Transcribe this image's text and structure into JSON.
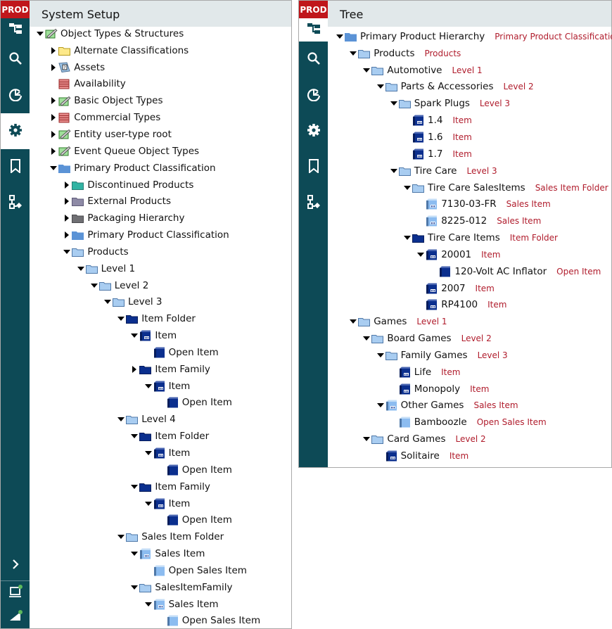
{
  "env_badge": "PROD",
  "left": {
    "title": "System Setup",
    "rail": [
      "hierarchy-icon",
      "search-icon",
      "refresh-icon",
      "gear-icon",
      "bookmark-icon",
      "workflow-icon"
    ],
    "active_rail": 3,
    "rail_bottom": [
      "expand-chevron-icon",
      "laptop-status-icon",
      "signal-status-icon"
    ],
    "tree": [
      {
        "d": 0,
        "t": "down",
        "i": "objtype",
        "l": "Object Types & Structures"
      },
      {
        "d": 1,
        "t": "right",
        "i": "folder-yellow",
        "l": "Alternate Classifications"
      },
      {
        "d": 1,
        "t": "right",
        "i": "asset",
        "l": "Assets"
      },
      {
        "d": 1,
        "t": "none",
        "i": "list-red",
        "l": "Availability"
      },
      {
        "d": 1,
        "t": "right",
        "i": "objtype",
        "l": "Basic Object Types"
      },
      {
        "d": 1,
        "t": "right",
        "i": "list-red",
        "l": "Commercial Types"
      },
      {
        "d": 1,
        "t": "right",
        "i": "objtype",
        "l": "Entity user-type root"
      },
      {
        "d": 1,
        "t": "right",
        "i": "objtype",
        "l": "Event Queue Object Types"
      },
      {
        "d": 1,
        "t": "down",
        "i": "folder-blue",
        "l": "Primary Product Classification"
      },
      {
        "d": 2,
        "t": "right",
        "i": "folder-teal",
        "l": "Discontinued Products"
      },
      {
        "d": 2,
        "t": "right",
        "i": "folder-purple",
        "l": "External Products"
      },
      {
        "d": 2,
        "t": "right",
        "i": "folder-gray",
        "l": "Packaging Hierarchy"
      },
      {
        "d": 2,
        "t": "right",
        "i": "folder-blue",
        "l": "Primary Product Classification"
      },
      {
        "d": 2,
        "t": "down",
        "i": "folder-light",
        "l": "Products"
      },
      {
        "d": 3,
        "t": "down",
        "i": "folder-light",
        "l": "Level 1"
      },
      {
        "d": 4,
        "t": "down",
        "i": "folder-light",
        "l": "Level 2"
      },
      {
        "d": 5,
        "t": "down",
        "i": "folder-light",
        "l": "Level 3"
      },
      {
        "d": 6,
        "t": "down",
        "i": "folder-dark",
        "l": "Item Folder"
      },
      {
        "d": 7,
        "t": "down",
        "i": "item",
        "l": "Item"
      },
      {
        "d": 8,
        "t": "none",
        "i": "open-item",
        "l": "Open Item"
      },
      {
        "d": 7,
        "t": "right",
        "i": "folder-dark",
        "l": "Item Family"
      },
      {
        "d": 8,
        "t": "down",
        "i": "item",
        "l": "Item"
      },
      {
        "d": 9,
        "t": "none",
        "i": "open-item",
        "l": "Open Item"
      },
      {
        "d": 6,
        "t": "down",
        "i": "folder-light",
        "l": "Level 4"
      },
      {
        "d": 7,
        "t": "down",
        "i": "folder-dark",
        "l": "Item Folder"
      },
      {
        "d": 8,
        "t": "down",
        "i": "item",
        "l": "Item"
      },
      {
        "d": 9,
        "t": "none",
        "i": "open-item",
        "l": "Open Item"
      },
      {
        "d": 7,
        "t": "down",
        "i": "folder-dark",
        "l": "Item Family"
      },
      {
        "d": 8,
        "t": "down",
        "i": "item",
        "l": "Item"
      },
      {
        "d": 9,
        "t": "none",
        "i": "open-item",
        "l": "Open Item"
      },
      {
        "d": 6,
        "t": "down",
        "i": "folder-light",
        "l": "Sales Item Folder"
      },
      {
        "d": 7,
        "t": "down",
        "i": "sales-item",
        "l": "Sales Item"
      },
      {
        "d": 8,
        "t": "none",
        "i": "open-sales",
        "l": "Open Sales Item"
      },
      {
        "d": 7,
        "t": "down",
        "i": "folder-light",
        "l": "SalesItemFamily"
      },
      {
        "d": 8,
        "t": "down",
        "i": "sales-item",
        "l": "Sales Item"
      },
      {
        "d": 9,
        "t": "none",
        "i": "open-sales",
        "l": "Open Sales Item"
      }
    ]
  },
  "right": {
    "title": "Tree",
    "rail": [
      "hierarchy-icon",
      "search-icon",
      "refresh-icon",
      "gear-icon",
      "bookmark-icon",
      "workflow-icon"
    ],
    "active_rail": 0,
    "tree": [
      {
        "d": 0,
        "t": "down",
        "i": "folder-blue",
        "l": "Primary Product Hierarchy",
        "s": "Primary Product Classification"
      },
      {
        "d": 1,
        "t": "down",
        "i": "folder-light",
        "l": "Products",
        "s": "Products"
      },
      {
        "d": 2,
        "t": "down",
        "i": "folder-light",
        "l": "Automotive",
        "s": "Level 1"
      },
      {
        "d": 3,
        "t": "down",
        "i": "folder-light",
        "l": "Parts & Accessories",
        "s": "Level 2"
      },
      {
        "d": 4,
        "t": "down",
        "i": "folder-light",
        "l": "Spark Plugs",
        "s": "Level 3"
      },
      {
        "d": 5,
        "t": "none",
        "i": "item",
        "l": "1.4",
        "s": "Item"
      },
      {
        "d": 5,
        "t": "none",
        "i": "item",
        "l": "1.6",
        "s": "Item"
      },
      {
        "d": 5,
        "t": "none",
        "i": "item",
        "l": "1.7",
        "s": "Item"
      },
      {
        "d": 4,
        "t": "down",
        "i": "folder-light",
        "l": "Tire Care",
        "s": "Level 3"
      },
      {
        "d": 5,
        "t": "down",
        "i": "folder-light",
        "l": "Tire Care SalesItems",
        "s": "Sales Item Folder"
      },
      {
        "d": 6,
        "t": "none",
        "i": "sales-item",
        "l": "7130-03-FR",
        "s": "Sales Item"
      },
      {
        "d": 6,
        "t": "none",
        "i": "sales-item",
        "l": "8225-012",
        "s": "Sales Item"
      },
      {
        "d": 5,
        "t": "down",
        "i": "folder-dark",
        "l": "Tire Care Items",
        "s": "Item Folder"
      },
      {
        "d": 6,
        "t": "down",
        "i": "item",
        "l": "20001",
        "s": "Item"
      },
      {
        "d": 7,
        "t": "none",
        "i": "open-item",
        "l": "120-Volt AC Inflator",
        "s": "Open Item"
      },
      {
        "d": 6,
        "t": "none",
        "i": "item",
        "l": "2007",
        "s": "Item"
      },
      {
        "d": 6,
        "t": "none",
        "i": "item",
        "l": "RP4100",
        "s": "Item"
      },
      {
        "d": 1,
        "t": "down",
        "i": "folder-light",
        "l": "Games",
        "s": "Level 1"
      },
      {
        "d": 2,
        "t": "down",
        "i": "folder-light",
        "l": "Board Games",
        "s": "Level 2"
      },
      {
        "d": 3,
        "t": "down",
        "i": "folder-light",
        "l": "Family Games",
        "s": "Level 3"
      },
      {
        "d": 4,
        "t": "none",
        "i": "item",
        "l": "Life",
        "s": "Item"
      },
      {
        "d": 4,
        "t": "none",
        "i": "item",
        "l": "Monopoly",
        "s": "Item"
      },
      {
        "d": 3,
        "t": "down",
        "i": "sales-item",
        "l": "Other Games",
        "s": "Sales Item"
      },
      {
        "d": 4,
        "t": "none",
        "i": "open-sales",
        "l": "Bamboozle",
        "s": "Open Sales Item"
      },
      {
        "d": 2,
        "t": "down",
        "i": "folder-light",
        "l": "Card Games",
        "s": "Level 2"
      },
      {
        "d": 3,
        "t": "none",
        "i": "item",
        "l": "Solitaire",
        "s": "Item"
      }
    ]
  },
  "colors": {
    "rail": "#0d4a56",
    "prod": "#c0161b",
    "subtitle": "#b01c2c",
    "header": "#e1e8ea"
  }
}
